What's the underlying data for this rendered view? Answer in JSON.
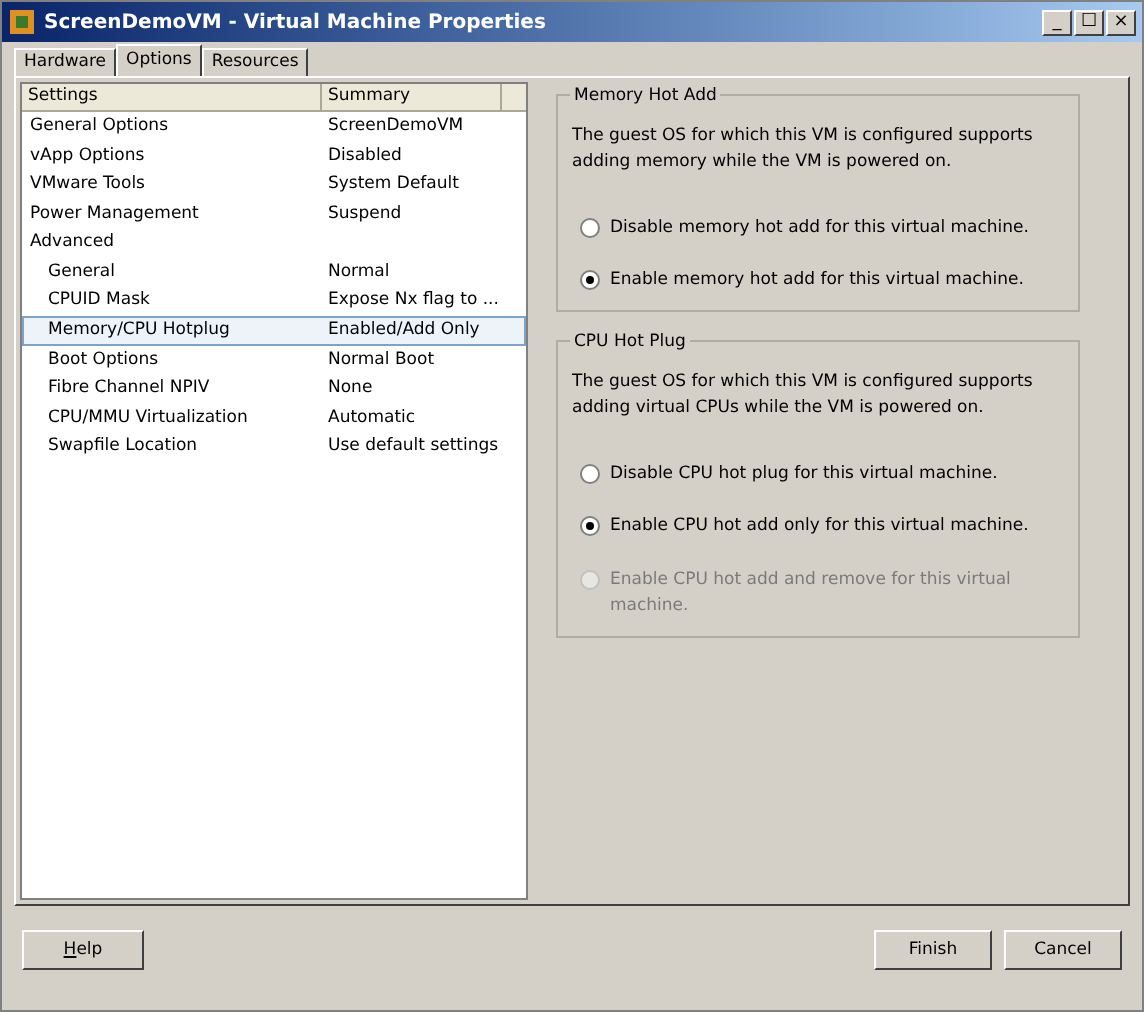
{
  "window": {
    "title": "ScreenDemoVM - Virtual Machine Properties",
    "controls": [
      "_",
      "☐",
      "×"
    ]
  },
  "tabs": [
    {
      "label": "Hardware",
      "selected": false
    },
    {
      "label": "Options",
      "selected": true
    },
    {
      "label": "Resources",
      "selected": false
    }
  ],
  "settings_list": {
    "columns": [
      "Settings",
      "Summary"
    ],
    "rows": [
      {
        "name": "General Options",
        "summary": "ScreenDemoVM",
        "selected": false
      },
      {
        "name": "vApp Options",
        "summary": "Disabled",
        "selected": false
      },
      {
        "name": "VMware Tools",
        "summary": "System Default",
        "selected": false
      },
      {
        "name": "Power Management",
        "summary": "Suspend",
        "selected": false
      },
      {
        "name": "Advanced",
        "selected": false,
        "children": [
          {
            "name": "General",
            "summary": "Normal",
            "selected": false
          },
          {
            "name": "CPUID Mask",
            "summary": "Expose Nx flag to ...",
            "selected": false
          },
          {
            "name": "Memory/CPU Hotplug",
            "summary": "Enabled/Add Only",
            "selected": true
          },
          {
            "name": "Boot Options",
            "summary": "Normal Boot",
            "selected": false
          },
          {
            "name": "Fibre Channel NPIV",
            "summary": "None",
            "selected": false
          },
          {
            "name": "CPU/MMU Virtualization",
            "summary": "Automatic",
            "selected": false
          },
          {
            "name": "Swapfile Location",
            "summary": "Use default settings",
            "selected": false
          }
        ]
      }
    ]
  },
  "groups": [
    {
      "title": "Memory Hot Add",
      "description": "The guest OS for which this VM is configured supports adding memory while the VM is powered on.",
      "options": [
        {
          "label": "Disable memory hot add for this virtual machine.",
          "selected": false,
          "disabled": false
        },
        {
          "label": "Enable memory hot add for this virtual machine.",
          "selected": true,
          "disabled": false
        }
      ]
    },
    {
      "title": "CPU Hot Plug",
      "description": "The guest OS for which this VM is configured supports adding virtual CPUs while the VM is powered on.",
      "options": [
        {
          "label": "Disable CPU hot plug for this virtual machine.",
          "selected": false,
          "disabled": false
        },
        {
          "label": "Enable CPU hot add only for this virtual machine.",
          "selected": true,
          "disabled": false
        },
        {
          "label": "Enable CPU hot add and remove for this virtual machine.",
          "selected": false,
          "disabled": true
        }
      ]
    }
  ],
  "buttons": {
    "left": [
      "Help"
    ],
    "right": [
      "Finish",
      "Cancel"
    ]
  }
}
